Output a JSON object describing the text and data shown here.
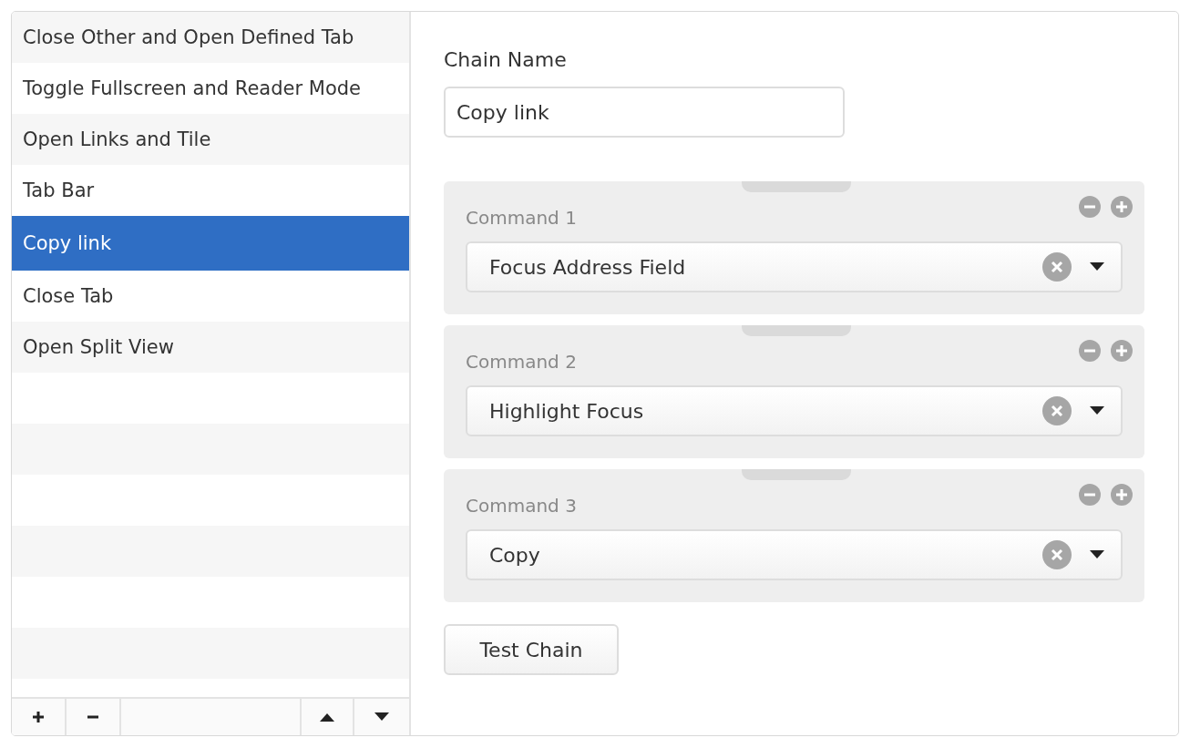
{
  "chains": [
    {
      "label": "Close Other and Open Defined Tab",
      "selected": false
    },
    {
      "label": "Toggle Fullscreen and Reader Mode",
      "selected": false
    },
    {
      "label": "Open Links and Tile",
      "selected": false
    },
    {
      "label": "Tab Bar",
      "selected": false
    },
    {
      "label": "Copy link",
      "selected": true
    },
    {
      "label": "Close Tab",
      "selected": false
    },
    {
      "label": "Open Split View",
      "selected": false
    }
  ],
  "editor": {
    "name_label": "Chain Name",
    "name_value": "Copy link",
    "commands": [
      {
        "label": "Command 1",
        "value": "Focus Address Field"
      },
      {
        "label": "Command 2",
        "value": "Highlight Focus"
      },
      {
        "label": "Command 3",
        "value": "Copy"
      }
    ],
    "test_button": "Test Chain"
  }
}
